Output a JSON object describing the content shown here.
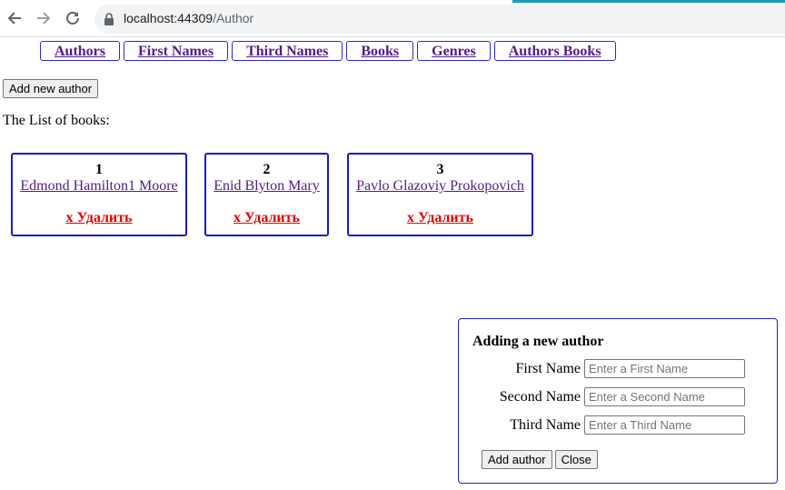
{
  "browser": {
    "url_host": "localhost:44309",
    "url_path": "/Author",
    "icons": {
      "back": "arrow-left-icon",
      "forward": "arrow-right-icon",
      "reload": "reload-icon",
      "lock": "lock-icon"
    }
  },
  "nav": {
    "links": [
      {
        "label": "Authors"
      },
      {
        "label": "First Names"
      },
      {
        "label": "Third Names"
      },
      {
        "label": "Books"
      },
      {
        "label": "Genres"
      },
      {
        "label": "Authors Books"
      }
    ]
  },
  "toolbar": {
    "add_new_author_label": "Add new author"
  },
  "list": {
    "title": "The List of books:",
    "authors": [
      {
        "id": "1",
        "name": "Edmond Hamilton1 Moore",
        "delete_label": "x Удалить"
      },
      {
        "id": "2",
        "name": "Enid Blyton Mary",
        "delete_label": "x Удалить"
      },
      {
        "id": "3",
        "name": "Pavlo Glazoviy Prokopovich",
        "delete_label": "x Удалить"
      }
    ]
  },
  "modal": {
    "title": "Adding a new author",
    "fields": [
      {
        "label": "First Name",
        "value": "",
        "placeholder": "Enter a First Name"
      },
      {
        "label": "Second Name",
        "value": "",
        "placeholder": "Enter a Second Name"
      },
      {
        "label": "Third Name",
        "value": "",
        "placeholder": "Enter a Third Name"
      }
    ],
    "add_label": "Add author",
    "close_label": "Close"
  },
  "colors": {
    "card_border": "#1a1acc",
    "link_visited": "#551a8b",
    "delete_red": "#e60000",
    "modal_border": "#2323c8"
  }
}
